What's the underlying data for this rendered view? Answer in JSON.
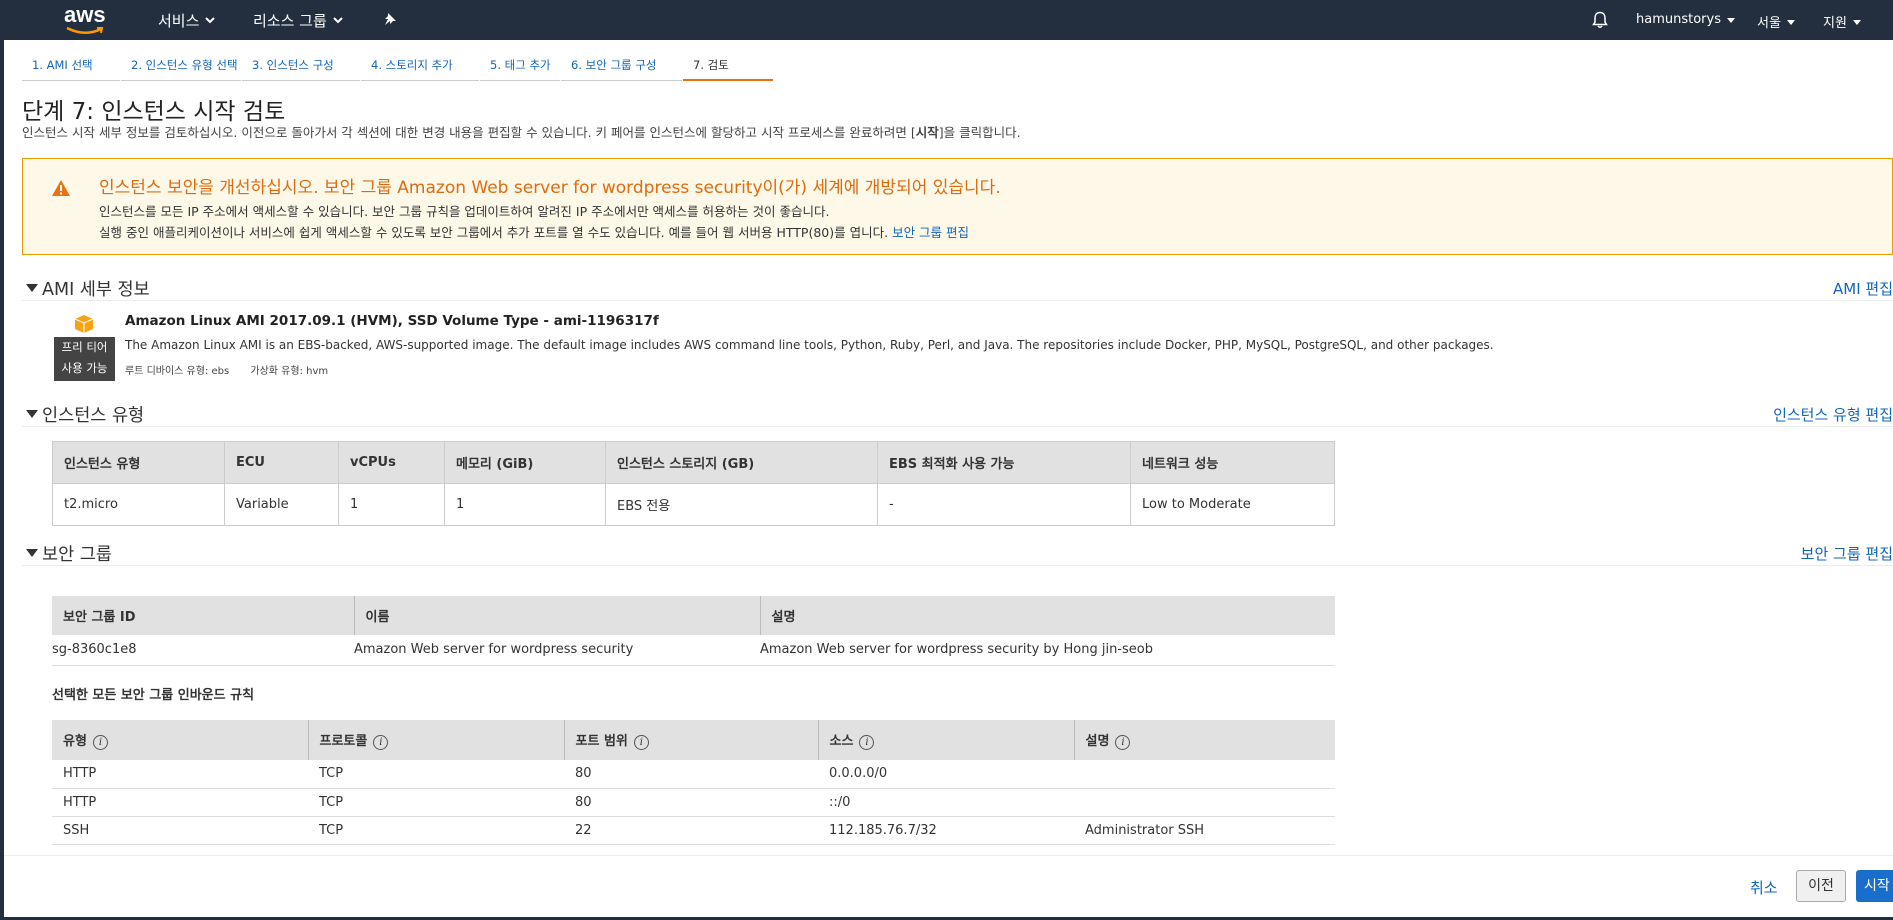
{
  "nav": {
    "logo": "aws",
    "services": "서비스",
    "resource_groups": "리소스 그룹",
    "user": "hamunstorys",
    "region": "서울",
    "support": "지원"
  },
  "steps": [
    "1. AMI 선택",
    "2. 인스턴스 유형 선택",
    "3. 인스턴스 구성",
    "4. 스토리지 추가",
    "5. 태그 추가",
    "6. 보안 그룹 구성",
    "7. 검토"
  ],
  "page": {
    "title": "단계 7: 인스턴스 시작 검토",
    "desc_before": "인스턴스 시작 세부 정보를 검토하십시오. 이전으로 돌아가서 각 섹션에 대한 변경 내용을 편집할 수 있습니다. 키 페어를 인스턴스에 할당하고 시작 프로세스를 완료하려면 [",
    "desc_bold": "시작",
    "desc_after": "]을 클릭합니다."
  },
  "warning": {
    "title": "인스턴스 보안을 개선하십시오. 보안 그룹 Amazon Web server for wordpress security이(가) 세계에 개방되어 있습니다.",
    "line1": "인스턴스를 모든 IP 주소에서 액세스할 수 있습니다. 보안 그룹 규칙을 업데이트하여 알려진 IP 주소에서만 액세스를 허용하는 것이 좋습니다.",
    "line2": "실행 중인 애플리케이션이나 서비스에 쉽게 액세스할 수 있도록 보안 그룹에서 추가 포트를 열 수도 있습니다. 예를 들어 웹 서버용 HTTP(80)를 엽니다.",
    "link": "보안 그룹 편집"
  },
  "ami": {
    "section_title": "AMI 세부 정보",
    "edit": "AMI 편집",
    "badge_line1": "프리 티어",
    "badge_line2": "사용 가능",
    "name": "Amazon Linux AMI 2017.09.1 (HVM), SSD Volume Type - ami-1196317f",
    "desc": "The Amazon Linux AMI is an EBS-backed, AWS-supported image. The default image includes AWS command line tools, Python, Ruby, Perl, and Java. The repositories include Docker, PHP, MySQL, PostgreSQL, and other packages.",
    "root_device": "루트 디바이스 유형: ebs",
    "virtualization": "가상화 유형: hvm"
  },
  "instance_type": {
    "section_title": "인스턴스 유형",
    "edit": "인스턴스 유형 편집",
    "headers": [
      "인스턴스 유형",
      "ECU",
      "vCPUs",
      "메모리 (GiB)",
      "인스턴스 스토리지 (GB)",
      "EBS 최적화 사용 가능",
      "네트워크 성능"
    ],
    "row": [
      "t2.micro",
      "Variable",
      "1",
      "1",
      "EBS 전용",
      "-",
      "Low to Moderate"
    ]
  },
  "security_group": {
    "section_title": "보안 그룹",
    "edit": "보안 그룹 편집",
    "headers": [
      "보안 그룹 ID",
      "이름",
      "설명"
    ],
    "row": [
      "sg-8360c1e8",
      "Amazon Web server for wordpress security",
      "Amazon Web server for wordpress security by Hong jin-seob"
    ],
    "inbound_title": "선택한 모든 보안 그룹 인바운드 규칙",
    "rule_headers": [
      "유형",
      "프로토콜",
      "포트 범위",
      "소스",
      "설명"
    ],
    "rules": [
      [
        "HTTP",
        "TCP",
        "80",
        "0.0.0.0/0",
        ""
      ],
      [
        "HTTP",
        "TCP",
        "80",
        "::/0",
        ""
      ],
      [
        "SSH",
        "TCP",
        "22",
        "112.185.76.7/32",
        "Administrator SSH"
      ]
    ]
  },
  "footer": {
    "cancel": "취소",
    "previous": "이전",
    "launch": "시작"
  }
}
